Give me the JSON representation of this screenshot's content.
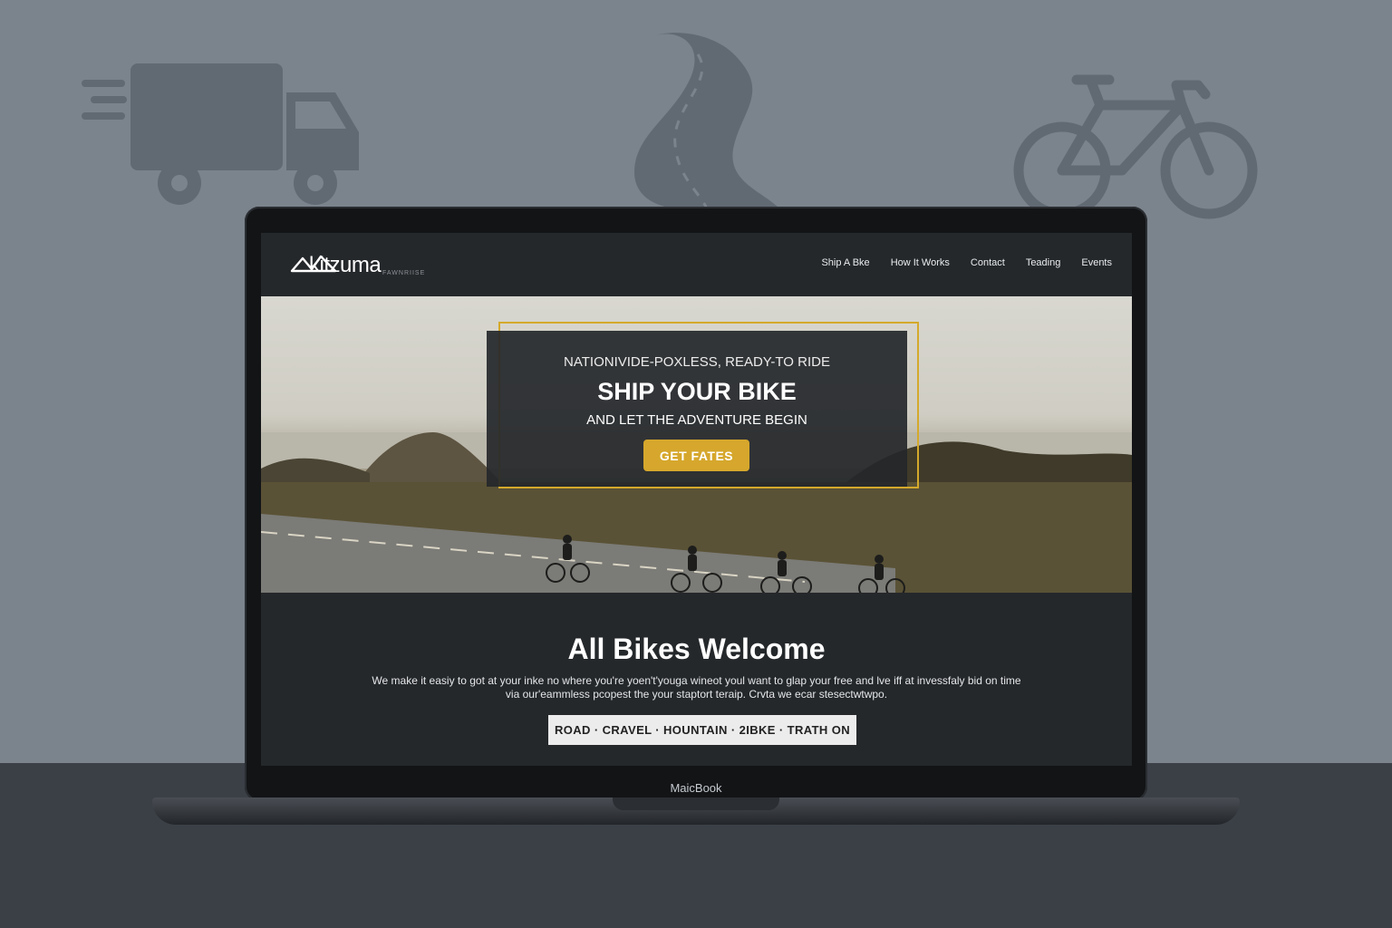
{
  "background_icons": [
    "delivery-truck-icon",
    "winding-road-icon",
    "bicycle-icon"
  ],
  "device": {
    "label": "MaicBook"
  },
  "site": {
    "logo": {
      "word": "kitzuma",
      "tagline": "FAWNRIISE"
    },
    "nav": [
      {
        "label": "Ship A Bke"
      },
      {
        "label": "How It Works"
      },
      {
        "label": "Contact"
      },
      {
        "label": "Teading"
      },
      {
        "label": "Events"
      }
    ],
    "hero": {
      "kicker": "NATIONIVIDE-POXLESS, READY-TO RIDE",
      "title": "SHIP YOUR BIKE",
      "subtitle": "AND LET THE ADVENTURE BEGIN",
      "cta": "GET FATES"
    },
    "welcome": {
      "title": "All Bikes Welcome",
      "text": "We make it easiy to got at your inke no where you're yoen't'youga wineot youl want to glap your free and lve iff at invessfaly bid on time via our'eammless pcopest the your staptort teraip. Crvta we ecar stesectwtwpo.",
      "tags": "ROAD · CRAVEL · HOUNTAIN · 2IBKE · TRATH ON"
    }
  },
  "colors": {
    "accent": "#d6a72c",
    "page_bg": "#7b838c",
    "screen_bg": "#26292c"
  }
}
